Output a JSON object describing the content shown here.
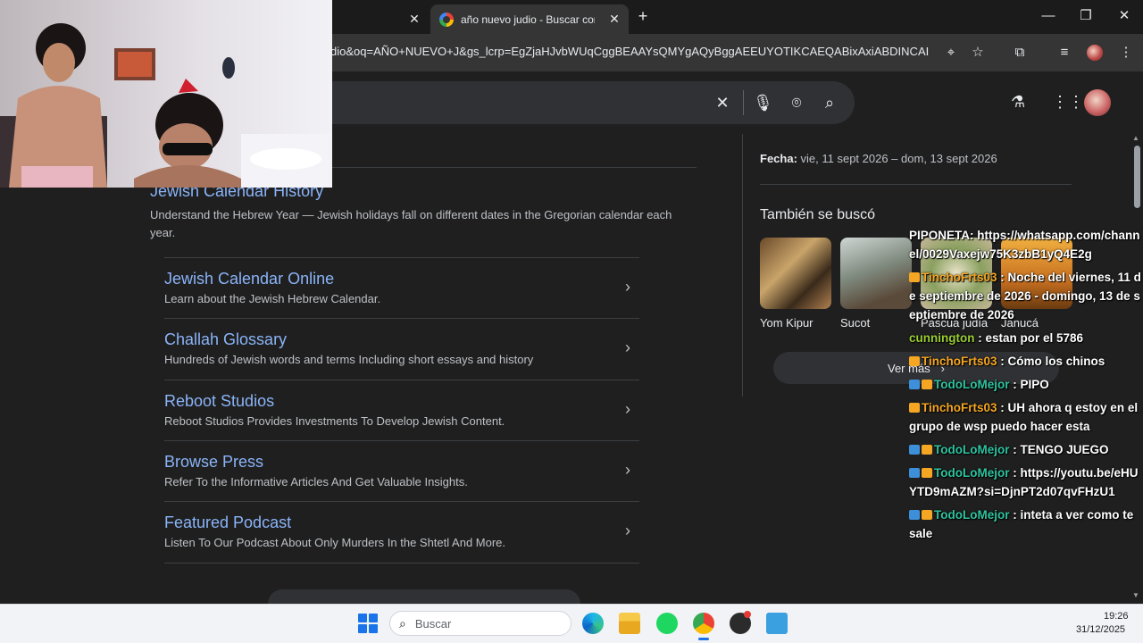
{
  "browser": {
    "tabs": [
      {
        "title": "",
        "active": false
      },
      {
        "title": "año nuevo judio - Buscar con Google",
        "active": true
      }
    ],
    "new_tab": "+",
    "url": "dio&oq=AÑO+NUEVO+J&gs_lcrp=EgZjaHJvbWUqCggBEAAYsQMYgAQyBggAEEUYOTIKCAEQABixAxiABDINCAIQA...",
    "window_controls": {
      "minimize": "—",
      "maximize": "❐",
      "close": "✕"
    }
  },
  "results": {
    "main_title": "Jewish Calendar History",
    "main_description": "Understand the Hebrew Year — Jewish holidays fall on different dates in the Gregorian calendar each year.",
    "sitelinks": [
      {
        "title": "Jewish Calendar Online",
        "description": "Learn about the Jewish Hebrew Calendar."
      },
      {
        "title": "Challah Glossary",
        "description": "Hundreds of Jewish words and terms Including short essays and history"
      },
      {
        "title": "Reboot Studios",
        "description": "Reboot Studios Provides Investments To Develop Jewish Content."
      },
      {
        "title": "Browse Press",
        "description": "Refer To the Informative Articles And Get Valuable Insights."
      },
      {
        "title": "Featured Podcast",
        "description": "Listen To Our Podcast About Only Murders In the Shtetl And More."
      }
    ]
  },
  "knowledge_panel": {
    "date_label": "Fecha:",
    "date_value": " vie, 11 sept 2026 – dom, 13 sept 2026",
    "also_searched_title": "También se buscó",
    "items": [
      {
        "label": "Yom Kipur"
      },
      {
        "label": "Sucot"
      },
      {
        "label": "Pascua judía"
      },
      {
        "label": "Janucá"
      }
    ],
    "see_more": "Ver más"
  },
  "chat": [
    {
      "user": "PIPONETA",
      "color": "#ffffff",
      "badges": [],
      "sep": ": ",
      "text": "https://whatsapp.com/channel/0029Vaxejw75K3zbB1yQ4E2g"
    },
    {
      "user": "TinchoFrts03",
      "color": "#f5a623",
      "badges": [
        "crown"
      ],
      "sep": " : ",
      "text": "Noche del viernes, 11 de septiembre de 2026 - domingo, 13 de septiembre de 2026"
    },
    {
      "user": "cunnington",
      "color": "#9acd32",
      "badges": [],
      "sep": " : ",
      "text": "estan por el 5786"
    },
    {
      "user": "TinchoFrts03",
      "color": "#f5a623",
      "badges": [
        "crown"
      ],
      "sep": " : ",
      "text": "Cómo los chinos"
    },
    {
      "user": "TodoLoMejor",
      "color": "#2ec4a0",
      "badges": [
        "arrow",
        "crown"
      ],
      "sep": " : ",
      "text": "PIPO"
    },
    {
      "user": "TinchoFrts03",
      "color": "#f5a623",
      "badges": [
        "crown"
      ],
      "sep": " : ",
      "text": "UH ahora q estoy en el grupo de wsp puedo hacer esta"
    },
    {
      "user": "TodoLoMejor",
      "color": "#2ec4a0",
      "badges": [
        "arrow",
        "crown"
      ],
      "sep": " : ",
      "text": "TENGO JUEGO"
    },
    {
      "user": "TodoLoMejor",
      "color": "#2ec4a0",
      "badges": [
        "arrow",
        "crown"
      ],
      "sep": " : ",
      "text": "https://youtu.be/eHUYTD9mAZM?si=DjnPT2d07qvFHzU1"
    },
    {
      "user": "TodoLoMejor",
      "color": "#2ec4a0",
      "badges": [
        "arrow",
        "crown"
      ],
      "sep": " : ",
      "text": "inteta a ver como te sale"
    }
  ],
  "taskbar": {
    "search_placeholder": "Buscar",
    "time": "19:26",
    "date": "31/12/2025"
  },
  "colors": {
    "link": "#8ab4f8",
    "background": "#1f1f1f",
    "taskbar": "#f1f3f6"
  }
}
